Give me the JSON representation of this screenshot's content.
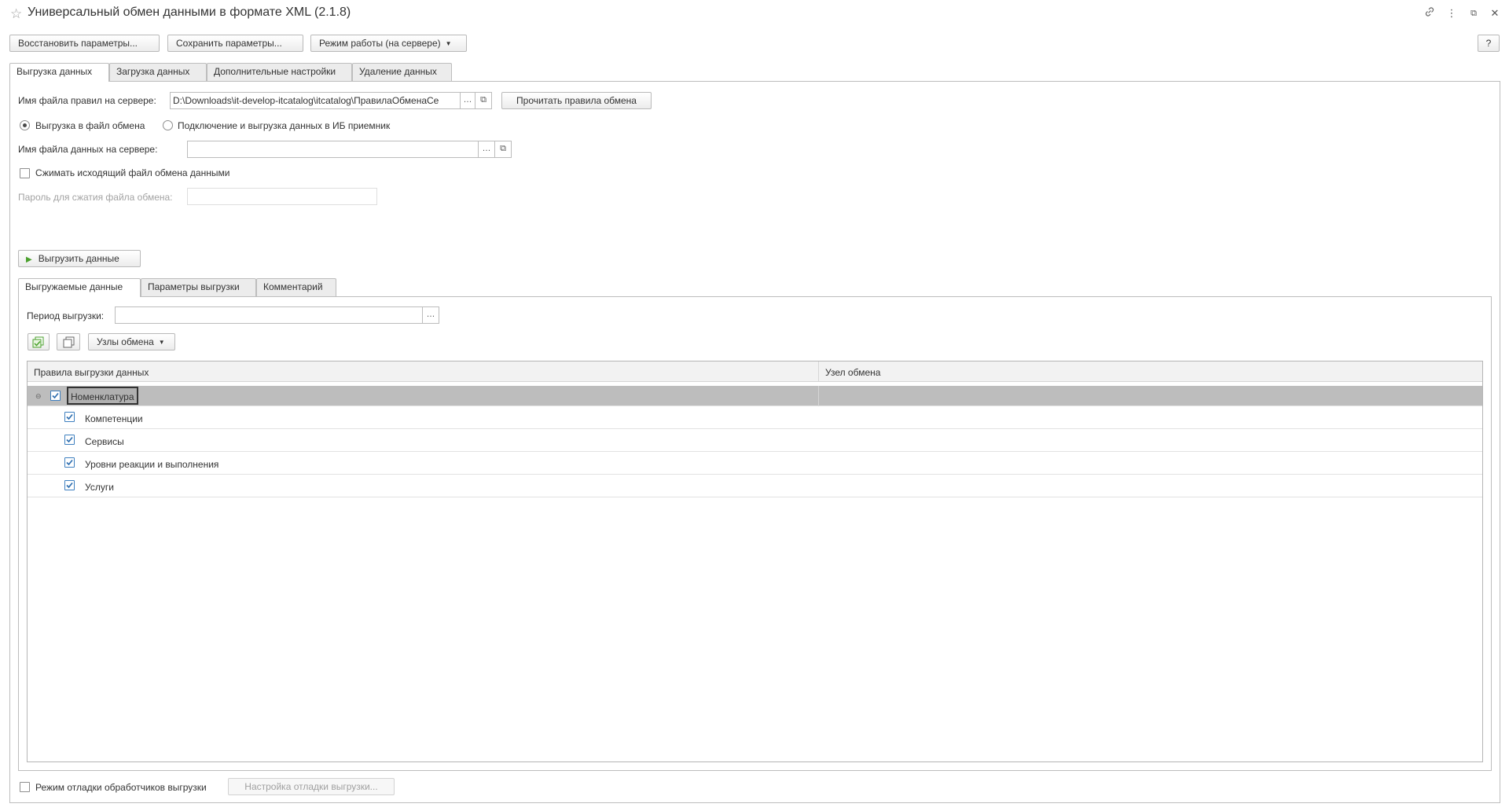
{
  "window": {
    "title": "Универсальный обмен данными в формате XML (2.1.8)",
    "controls": {
      "link": "🔗",
      "more": "⋮",
      "restore": "⧉",
      "close": "✕"
    }
  },
  "toolbar": {
    "restore_params": "Восстановить параметры...",
    "save_params": "Сохранить параметры...",
    "mode": "Режим работы (на сервере)",
    "help": "?"
  },
  "tabs": [
    {
      "label": "Выгрузка данных",
      "active": true
    },
    {
      "label": "Загрузка данных",
      "active": false
    },
    {
      "label": "Дополнительные настройки",
      "active": false
    },
    {
      "label": "Удаление данных",
      "active": false
    }
  ],
  "export": {
    "rules_file_label": "Имя файла правил на сервере:",
    "rules_file_value": "D:\\Downloads\\it-develop-itcatalog\\itcatalog\\ПравилаОбменаСе",
    "read_rules_button": "Прочитать правила обмена",
    "radio_file": "Выгрузка в файл обмена",
    "radio_file_checked": true,
    "radio_ib": "Подключение и выгрузка данных в ИБ приемник",
    "radio_ib_checked": false,
    "data_file_label": "Имя файла данных на сервере:",
    "data_file_value": "",
    "compress_label": "Сжимать исходящий файл обмена данными",
    "compress_checked": false,
    "password_label": "Пароль для сжатия файла обмена:",
    "password_value": "",
    "run_button": "Выгрузить данные"
  },
  "subtabs": [
    {
      "label": "Выгружаемые данные",
      "active": true
    },
    {
      "label": "Параметры выгрузки",
      "active": false
    },
    {
      "label": "Комментарий",
      "active": false
    }
  ],
  "period": {
    "label": "Период выгрузки:",
    "value": ""
  },
  "nodes_button": "Узлы обмена",
  "table": {
    "columns": [
      "Правила выгрузки данных",
      "Узел обмена"
    ],
    "rows": [
      {
        "name": "Номенклатура",
        "checked": true,
        "level": 0,
        "group": true,
        "node": ""
      },
      {
        "name": "Компетенции",
        "checked": true,
        "level": 1,
        "node": ""
      },
      {
        "name": "Сервисы",
        "checked": true,
        "level": 1,
        "node": ""
      },
      {
        "name": "Уровни реакции и выполнения",
        "checked": true,
        "level": 1,
        "node": ""
      },
      {
        "name": "Услуги",
        "checked": true,
        "level": 1,
        "node": ""
      }
    ]
  },
  "debug": {
    "mode_label": "Режим отладки обработчиков выгрузки",
    "mode_checked": false,
    "settings_button": "Настройка отладки выгрузки..."
  },
  "colors": {
    "accent": "#3d7fbf",
    "run_icon": "#4aa02c",
    "selected_row": "#bdbdbd"
  }
}
